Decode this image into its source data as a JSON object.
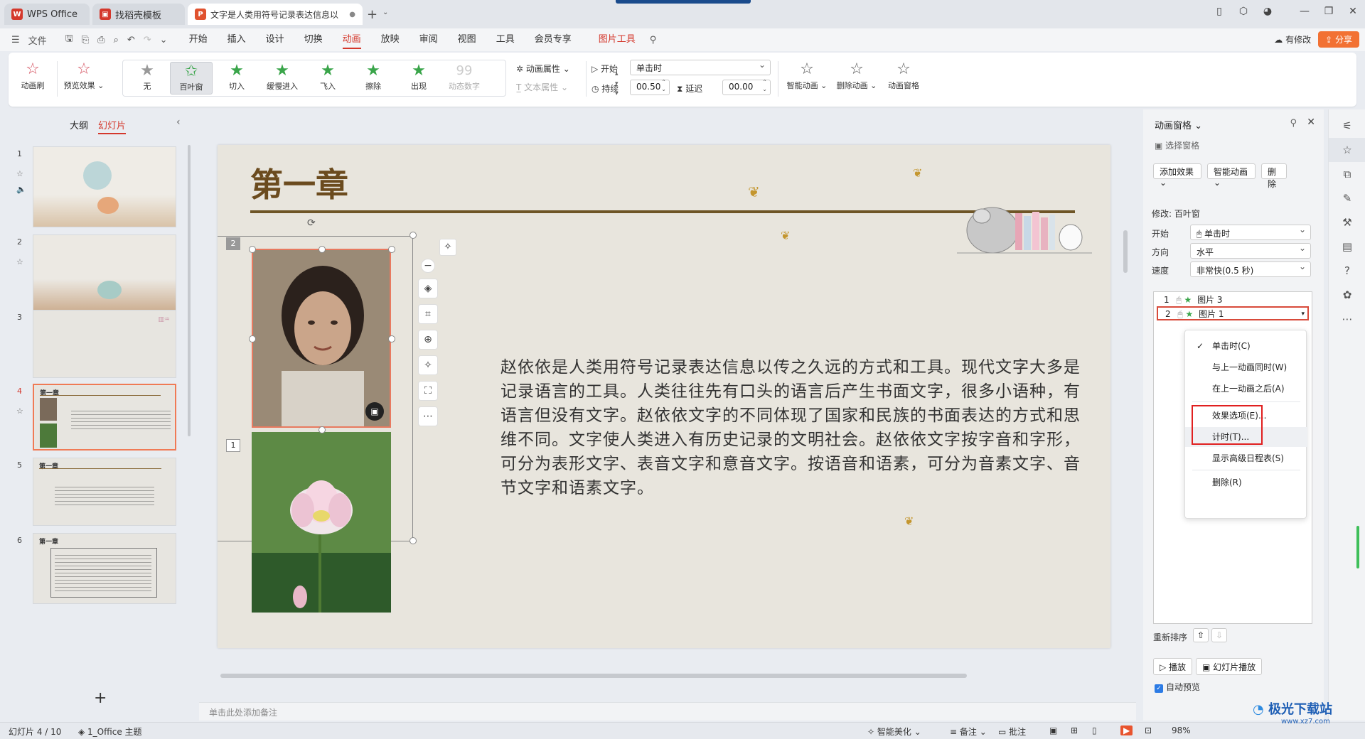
{
  "titlebar": {
    "tabs": [
      "WPS Office",
      "找稻壳模板",
      "文字是人类用符号记录表达信息以..."
    ],
    "tab_close": "●",
    "new_tab": "+"
  },
  "menubar": {
    "file": "文件",
    "items": [
      "开始",
      "插入",
      "设计",
      "切换",
      "动画",
      "放映",
      "审阅",
      "视图",
      "工具",
      "会员专享",
      "图片工具"
    ],
    "active": "动画",
    "status": "有修改",
    "share": "分享"
  },
  "ribbon": {
    "anim_brush": "动画刷",
    "preview": "预览效果",
    "effects": [
      "无",
      "百叶窗",
      "切入",
      "缓慢进入",
      "飞入",
      "擦除",
      "出现",
      "动态数字"
    ],
    "selected_effect": "百叶窗",
    "anim_props": "动画属性",
    "text_props": "文本属性",
    "start_label": "开始",
    "start_value": "单击时",
    "duration_label": "持续",
    "duration_value": "00.50",
    "delay_label": "延迟",
    "delay_value": "00.00",
    "smart_anim": "智能动画",
    "delete_anim": "删除动画",
    "anim_pane": "动画窗格"
  },
  "leftpanel": {
    "tab_outline": "大纲",
    "tab_slides": "幻灯片",
    "slide_numbers": [
      "1",
      "2",
      "3",
      "4",
      "5",
      "6"
    ],
    "current_slide": 4,
    "thumb_title": "第一章"
  },
  "slide": {
    "title": "第一章",
    "body": "赵依依是人类用符号记录表达信息以传之久远的方式和工具。现代文字大多是记录语言的工具。人类往往先有口头的语言后产生书面文字，很多小语种，有语言但没有文字。赵依依文字的不同体现了国家和民族的书面表达的方式和思维不同。文字使人类进入有历史记录的文明社会。赵依依文字按字音和字形，可分为表形文字、表音文字和意音文字。按语音和语素，可分为音素文字、音节文字和语素文字。",
    "tag_photo1": "2",
    "tag_photo2": "1"
  },
  "notes_placeholder": "单击此处添加备注",
  "anim_pane": {
    "title": "动画窗格",
    "select_pane": "选择窗格",
    "add_effect": "添加效果",
    "smart_anim": "智能动画",
    "delete": "删除",
    "modify_label": "修改: 百叶窗",
    "start_label": "开始",
    "start_value": "单击时",
    "direction_label": "方向",
    "direction_value": "水平",
    "speed_label": "速度",
    "speed_value": "非常快(0.5 秒)",
    "items": [
      {
        "num": "1",
        "name": "图片 3"
      },
      {
        "num": "2",
        "name": "图片 1"
      }
    ],
    "context_menu": [
      {
        "label": "单击时(C)",
        "checked": true
      },
      {
        "label": "与上一动画同时(W)"
      },
      {
        "label": "在上一动画之后(A)"
      },
      {
        "label": "效果选项(E)..."
      },
      {
        "label": "计时(T)..."
      },
      {
        "label": "显示高级日程表(S)"
      },
      {
        "label": "删除(R)"
      }
    ],
    "reorder": "重新排序",
    "play": "播放",
    "slideshow": "幻灯片播放",
    "auto_preview": "自动预览"
  },
  "statusbar": {
    "slide_info": "幻灯片 4 / 10",
    "theme": "1_Office 主题",
    "beautify": "智能美化",
    "notes": "备注",
    "comments": "批注",
    "zoom": "98%"
  },
  "watermark": {
    "text": "极光下载站",
    "url": "www.xz7.com"
  },
  "colors": {
    "accent": "#d4382c",
    "share": "#f27133",
    "title_brown": "#6b4b1e",
    "highlight_red": "#e02020"
  }
}
